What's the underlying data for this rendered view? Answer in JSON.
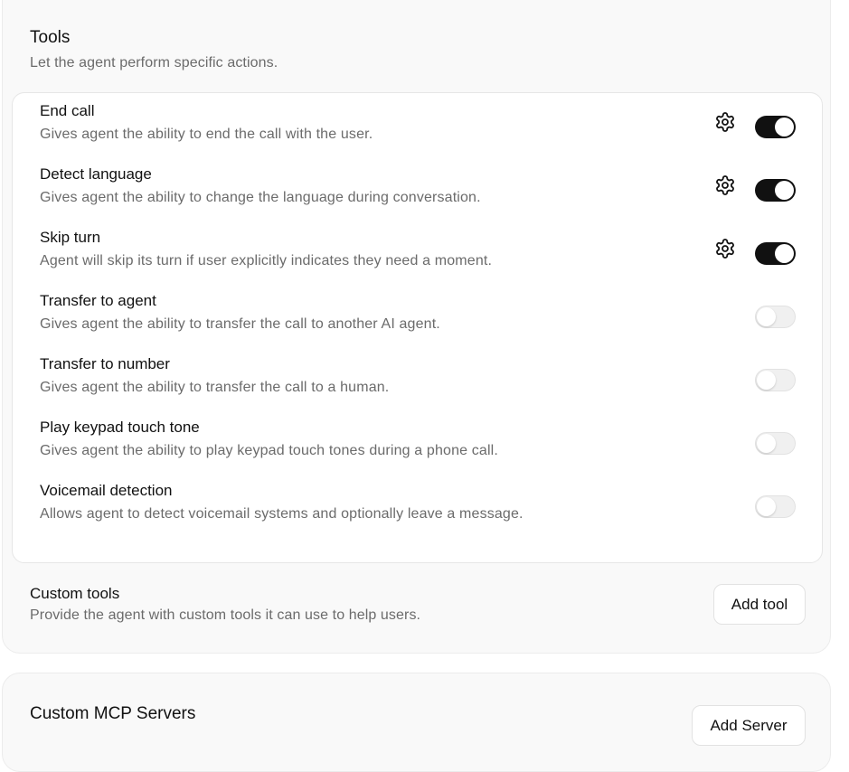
{
  "tools": {
    "title": "Tools",
    "description": "Let the agent perform specific actions.",
    "items": [
      {
        "title": "End call",
        "description": "Gives agent the ability to end the call with the user.",
        "enabled": true,
        "has_settings": true
      },
      {
        "title": "Detect language",
        "description": "Gives agent the ability to change the language during conversation.",
        "enabled": true,
        "has_settings": true
      },
      {
        "title": "Skip turn",
        "description": "Agent will skip its turn if user explicitly indicates they need a moment.",
        "enabled": true,
        "has_settings": true
      },
      {
        "title": "Transfer to agent",
        "description": "Gives agent the ability to transfer the call to another AI agent.",
        "enabled": false,
        "has_settings": false
      },
      {
        "title": "Transfer to number",
        "description": "Gives agent the ability to transfer the call to a human.",
        "enabled": false,
        "has_settings": false
      },
      {
        "title": "Play keypad touch tone",
        "description": "Gives agent the ability to play keypad touch tones during a phone call.",
        "enabled": false,
        "has_settings": false
      },
      {
        "title": "Voicemail detection",
        "description": "Allows agent to detect voicemail systems and optionally leave a message.",
        "enabled": false,
        "has_settings": false
      }
    ]
  },
  "custom_tools": {
    "title": "Custom tools",
    "description": "Provide the agent with custom tools it can use to help users.",
    "button_label": "Add tool"
  },
  "mcp": {
    "title": "Custom MCP Servers",
    "button_label": "Add Server"
  },
  "icons": {
    "settings": "gear-icon"
  },
  "colors": {
    "toggle_on": "#111111",
    "toggle_off": "#f0f0f0",
    "description_text": "#6b6b6b"
  }
}
